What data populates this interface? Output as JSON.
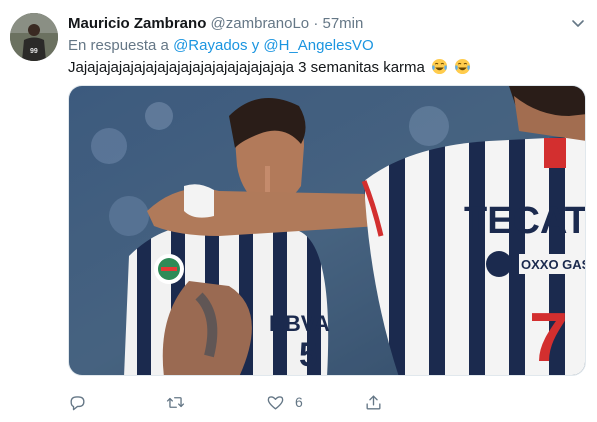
{
  "tweet": {
    "author_name": "Mauricio Zambrano",
    "author_handle": "@zambranoLo",
    "separator": "·",
    "time": "57min",
    "reply_prefix": "En respuesta a",
    "reply_user1": "@Rayados",
    "reply_join": "y",
    "reply_user2": "@H_AngelesVO",
    "text": "Jajajajajajajajajajajajajajajajajajaja 3 semanitas karma",
    "emojis": [
      "face-with-tears-of-joy",
      "face-with-tears-of-joy"
    ],
    "image": {
      "jersey_sponsor": "TECAT",
      "sleeve_brand": "OXXO GAS",
      "chest_sponsor": "BBVA",
      "number": "7",
      "number_small": "5"
    },
    "actions": {
      "reply_icon": "speech-bubble-icon",
      "retweet_icon": "retweet-icon",
      "like_icon": "heart-icon",
      "like_count": "6",
      "share_icon": "share-icon"
    }
  },
  "colors": {
    "link": "#1b95e0",
    "secondary_text": "#657786",
    "primary_text": "#14171a"
  }
}
